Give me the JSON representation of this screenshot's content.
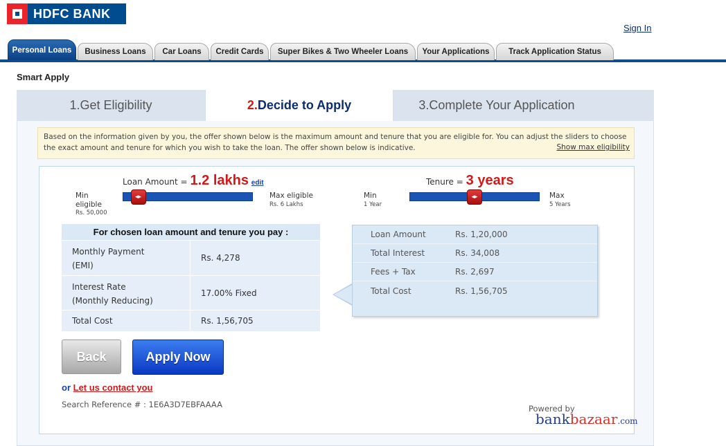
{
  "brand": {
    "name": "HDFC BANK"
  },
  "header": {
    "signin": "Sign In"
  },
  "nav": {
    "tabs": [
      {
        "label": "Personal Loans"
      },
      {
        "label": "Business Loans"
      },
      {
        "label": "Car Loans"
      },
      {
        "label": "Credit Cards"
      },
      {
        "label": "Super Bikes & Two Wheeler Loans"
      },
      {
        "label": "Your Applications"
      },
      {
        "label": "Track Application Status"
      }
    ]
  },
  "page": {
    "title": "Smart Apply"
  },
  "steps": [
    {
      "label": "1.Get Eligibility"
    },
    {
      "num": "2.",
      "label": "Decide to Apply"
    },
    {
      "label": "3.Complete Your Application"
    }
  ],
  "notice": {
    "text": "Based on the information given by you, the offer shown below is the maximum amount and tenure that you are eligible for. You can adjust the sliders to choose the exact amount and tenure for which you wish to take the loan. The offer shown below is indicative.",
    "link": "Show max eligibility"
  },
  "loan_slider": {
    "label": "Loan Amount =",
    "value": "1.2 lakhs",
    "edit": "edit",
    "min_label": "Min\neligible",
    "min_value": "Rs. 50,000",
    "max_label": "Max eligible",
    "max_value": "Rs. 6 Lakhs",
    "position": 0.12
  },
  "tenure_slider": {
    "label": "Tenure =",
    "value": "3 years",
    "min_label": "Min",
    "min_value": "1 Year",
    "max_label": "Max",
    "max_value": "5 Years",
    "position": 0.5
  },
  "pay_table": {
    "heading": "For chosen loan amount and tenure you pay :",
    "rows": [
      {
        "label": "Monthly Payment\n(EMI)",
        "value": "Rs. 4,278"
      },
      {
        "label": "Interest Rate\n(Monthly Reducing)",
        "value": "17.00% Fixed"
      },
      {
        "label": "Total Cost",
        "value": "Rs. 1,56,705"
      }
    ]
  },
  "summary": [
    {
      "label": "Loan Amount",
      "value": "Rs. 1,20,000"
    },
    {
      "label": "Total Interest",
      "value": "Rs. 34,008"
    },
    {
      "label": "Fees + Tax",
      "value": "Rs. 2,697"
    },
    {
      "label": "Total Cost",
      "value": "Rs. 1,56,705"
    }
  ],
  "actions": {
    "back": "Back",
    "apply": "Apply  Now"
  },
  "contact": {
    "or": "or",
    "link": "Let us contact you"
  },
  "reference": {
    "text": "Search Reference # : 1E6A3D7EBFAAAA"
  },
  "powered": {
    "label": "Powered by",
    "brand1": "bank",
    "brand2": "bazaar",
    "brand3": ".com"
  }
}
